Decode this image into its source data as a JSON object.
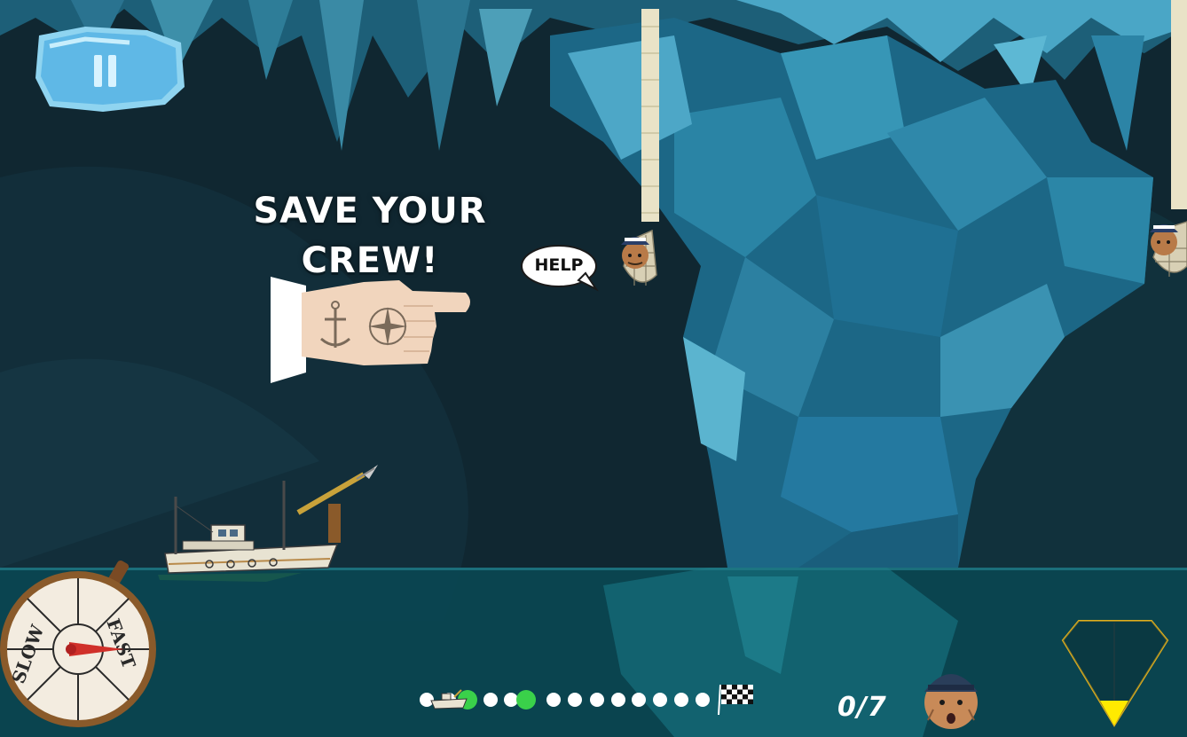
{
  "hud": {
    "pause_icon": "pause-icon",
    "tutorial_line1": "SAVE YOUR",
    "tutorial_line2": "CREW!",
    "help_bubble": "HELP",
    "crew_rescued": 0,
    "crew_total": 7,
    "crew_counter": "0/7",
    "speed_dial": {
      "slow_label": "SLOW",
      "fast_label": "FAST"
    },
    "progress": {
      "dots": 13,
      "boat_position": 0.0,
      "rescue_markers": [
        1,
        3
      ],
      "finish_icon": "checkered-flag-icon"
    },
    "compass_icon": "sonar-triangle-icon"
  },
  "colors": {
    "cave_dark": "#0f2630",
    "ice_blue": "#1f6d8a",
    "ice_light": "#5fb5d0",
    "water": "#0c4a55",
    "accent_yellow": "#ffea00",
    "marker_green": "#3ad14a"
  }
}
